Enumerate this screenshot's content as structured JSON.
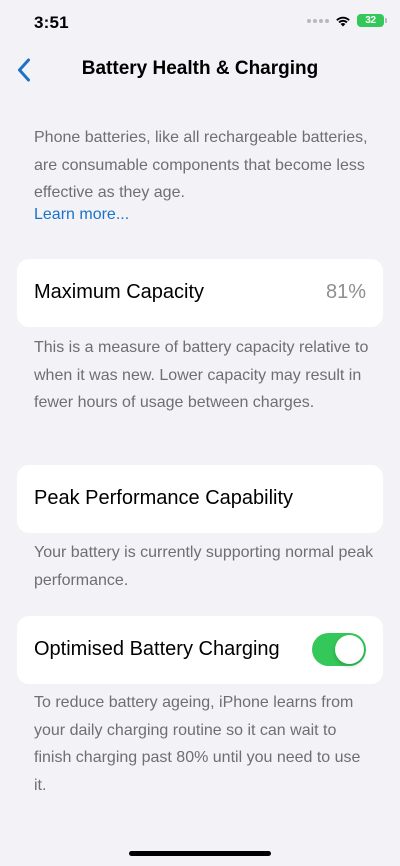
{
  "status_bar": {
    "time": "3:51",
    "battery_level": "32"
  },
  "nav": {
    "back_icon": "chevron-left-icon",
    "title": "Battery Health & Charging"
  },
  "intro": {
    "text": "Phone batteries, like all rechargeable batteries, are consumable components that become less effective as they age.",
    "learn_more": "Learn more..."
  },
  "maximum_capacity": {
    "label": "Maximum Capacity",
    "value": "81%",
    "footnote": "This is a measure of battery capacity relative to when it was new. Lower capacity may result in fewer hours of usage between charges."
  },
  "peak_performance": {
    "label": "Peak Performance Capability",
    "footnote": "Your battery is currently supporting normal peak performance."
  },
  "optimised_charging": {
    "label": "Optimised Battery Charging",
    "enabled": true,
    "footnote": "To reduce battery ageing, iPhone learns from your daily charging routine so it can wait to finish charging past 80% until you need to use it."
  },
  "colors": {
    "accent": "#1a73c9",
    "toggle_on": "#34c759",
    "background": "#f2f2f7"
  }
}
